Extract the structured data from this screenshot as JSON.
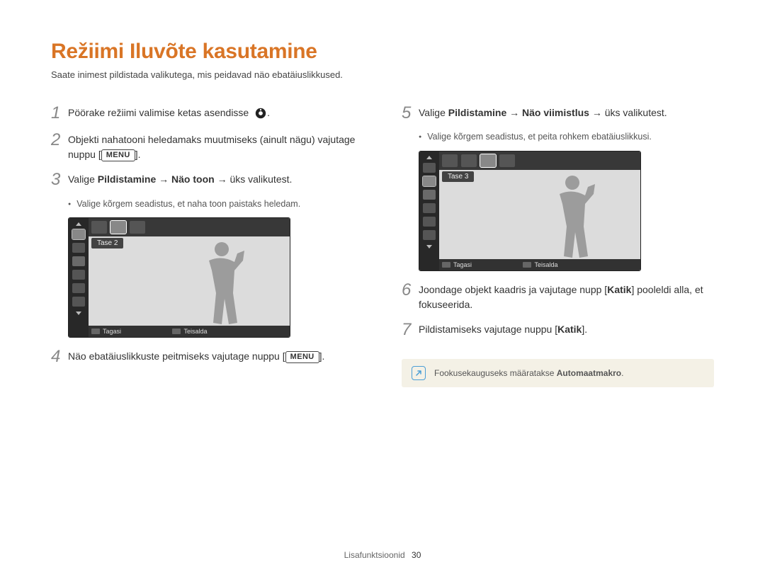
{
  "page": {
    "title": "Režiimi Iluvõte kasutamine",
    "subtitle": "Saate inimest pildistada valikutega, mis peidavad näo ebatäiuslikkused."
  },
  "left": {
    "step1": "Pöörake režiimi valimise ketas asendisse",
    "step2_a": "Objekti nahatooni heledamaks muutmiseks (ainult nägu) vajutage nuppu [",
    "step2_b": "].",
    "step3_a": "Valige ",
    "step3_b": "Pildistamine",
    "step3_c": " → ",
    "step3_d": "Näo toon",
    "step3_e": " → üks valikutest.",
    "bullet3": "Valige kõrgem seadistus, et naha toon paistaks heledam.",
    "lcd_level": "Tase 2",
    "lcd_back": "Tagasi",
    "lcd_move": "Teisalda",
    "lcd_menu": "MENU",
    "step4_a": "Näo ebatäiuslikkuste peitmiseks vajutage nuppu [",
    "step4_b": "]."
  },
  "right": {
    "step5_a": "Valige ",
    "step5_b": "Pildistamine",
    "step5_c": " → ",
    "step5_d": "Näo viimistlus",
    "step5_e": " → üks valikutest.",
    "bullet5": "Valige kõrgem seadistus, et peita rohkem ebatäiuslikkusi.",
    "lcd_level": "Tase 3",
    "lcd_back": "Tagasi",
    "lcd_move": "Teisalda",
    "lcd_menu": "MENU",
    "step6_a": "Joondage objekt kaadris ja vajutage nupp [",
    "step6_b": "Katik",
    "step6_c": "] pooleldi alla, et fokuseerida.",
    "step7_a": "Pildistamiseks vajutage nuppu [",
    "step7_b": "Katik",
    "step7_c": "].",
    "note_a": "Fookusekauguseks määratakse ",
    "note_b": "Automaatmakro",
    "note_c": "."
  },
  "labels": {
    "menu": "MENU"
  },
  "footer": {
    "section": "Lisafunktsioonid",
    "page": "30"
  }
}
